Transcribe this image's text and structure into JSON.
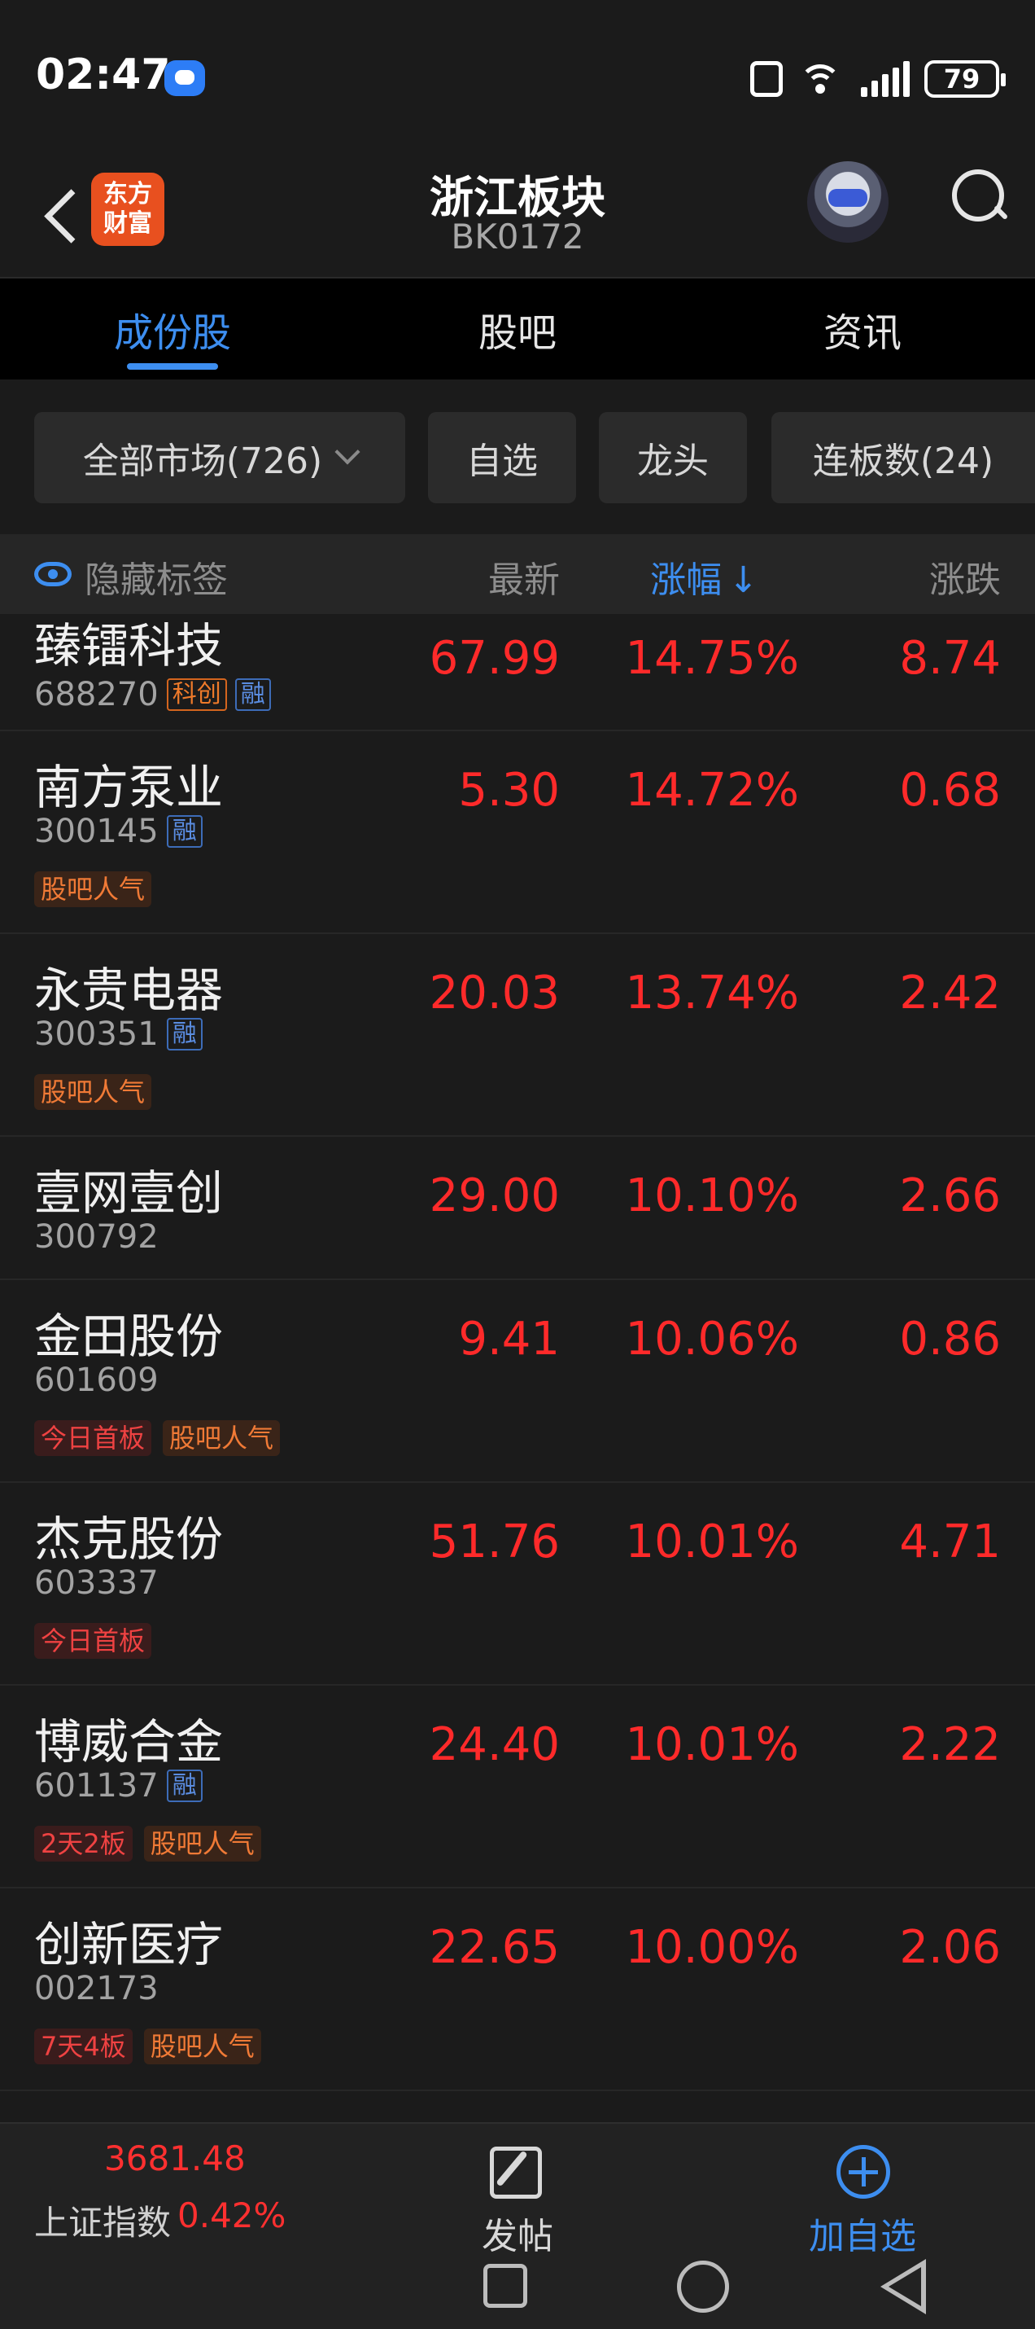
{
  "status_bar": {
    "time": "02:47",
    "battery": "79"
  },
  "header": {
    "title": "浙江板块",
    "subtitle": "BK0172",
    "logo_line1": "东方",
    "logo_line2": "财富"
  },
  "tabs": [
    {
      "label": "成份股",
      "active": true
    },
    {
      "label": "股吧",
      "active": false
    },
    {
      "label": "资讯",
      "active": false
    }
  ],
  "filters": {
    "market": "全部市场(726)",
    "watch": "自选",
    "leader": "龙头",
    "streak": "连板数(24)"
  },
  "columns": {
    "hide": "隐藏标签",
    "price": "最新",
    "pct": "涨幅",
    "pct_sort": "↓",
    "change": "涨跌"
  },
  "stocks": [
    {
      "name": "臻镭科技",
      "code": "688270",
      "badges": [
        "科创",
        "融"
      ],
      "tags": [],
      "price": "67.99",
      "pct": "14.75%",
      "change": "8.74"
    },
    {
      "name": "南方泵业",
      "code": "300145",
      "badges": [
        "融"
      ],
      "tags": [
        "股吧人气"
      ],
      "price": "5.30",
      "pct": "14.72%",
      "change": "0.68"
    },
    {
      "name": "永贵电器",
      "code": "300351",
      "badges": [
        "融"
      ],
      "tags": [
        "股吧人气"
      ],
      "price": "20.03",
      "pct": "13.74%",
      "change": "2.42"
    },
    {
      "name": "壹网壹创",
      "code": "300792",
      "badges": [],
      "tags": [],
      "price": "29.00",
      "pct": "10.10%",
      "change": "2.66"
    },
    {
      "name": "金田股份",
      "code": "601609",
      "badges": [],
      "tags": [
        "今日首板",
        "股吧人气"
      ],
      "price": "9.41",
      "pct": "10.06%",
      "change": "0.86"
    },
    {
      "name": "杰克股份",
      "code": "603337",
      "badges": [],
      "tags": [
        "今日首板"
      ],
      "price": "51.76",
      "pct": "10.01%",
      "change": "4.71"
    },
    {
      "name": "博威合金",
      "code": "601137",
      "badges": [
        "融"
      ],
      "tags": [
        "2天2板",
        "股吧人气"
      ],
      "price": "24.40",
      "pct": "10.01%",
      "change": "2.22"
    },
    {
      "name": "创新医疗",
      "code": "002173",
      "badges": [],
      "tags": [
        "7天4板",
        "股吧人气"
      ],
      "price": "22.65",
      "pct": "10.00%",
      "change": "2.06"
    }
  ],
  "bottom": {
    "index_value": "3681.48",
    "index_name": "上证指数",
    "index_pct": "0.42%",
    "post_label": "发帖",
    "add_label": "加自选"
  },
  "colors": {
    "up": "#ff2a2a",
    "accent": "#3d8ef0",
    "background": "#1b1b1b"
  }
}
